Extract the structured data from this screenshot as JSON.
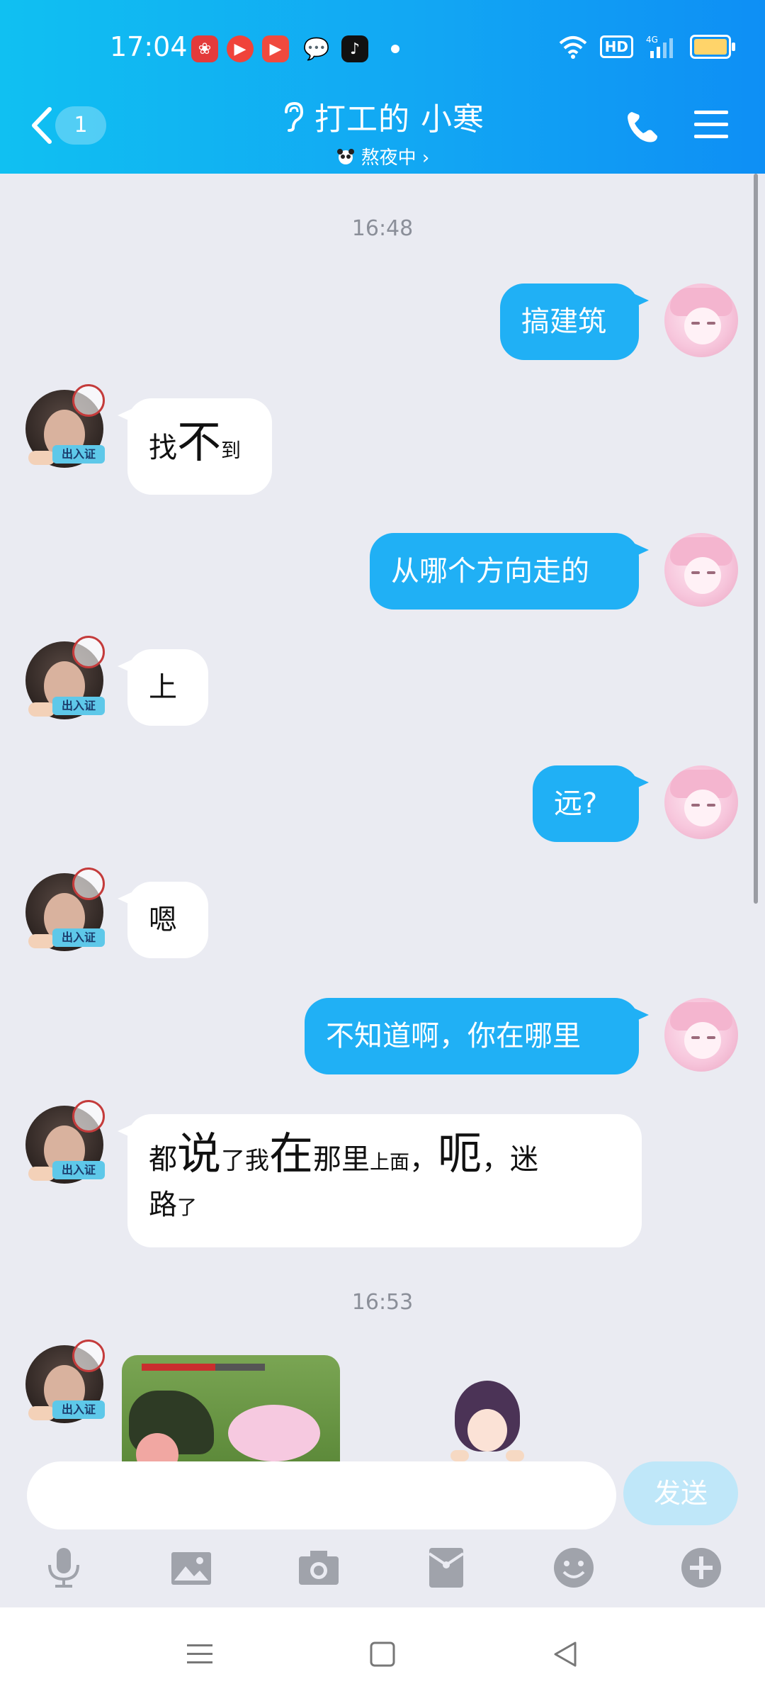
{
  "status_bar": {
    "time": "17:04",
    "hd": "HD",
    "network": "4G"
  },
  "header": {
    "back_count": "1",
    "title": "打工的 小寒",
    "subtitle": "熬夜中 ›"
  },
  "messages": {
    "t1": "16:48",
    "m1": "搞建筑",
    "m2_a": "找",
    "m2_b": "不",
    "m2_c": "到",
    "m3": "从哪个方向走的",
    "m4": "上",
    "m5": "远?",
    "m6": "嗯",
    "m7": "不知道啊，你在哪里",
    "m8": {
      "p1": "都",
      "p2": "说",
      "p3": "了我",
      "p4": "在",
      "p5": "那里",
      "p6": "上面",
      "p7": "，",
      "p8": "呃",
      "p9": "，迷",
      "p10": "路",
      "p11": "了"
    },
    "t2": "16:53"
  },
  "input": {
    "placeholder": "",
    "send_label": "发送"
  },
  "avatar_tag": "出入证",
  "colors": {
    "header_start": "#10c0f2",
    "header_end": "#0e8ff5",
    "bubble_me": "#20b0f5",
    "send_disabled": "#bfe7f9"
  }
}
